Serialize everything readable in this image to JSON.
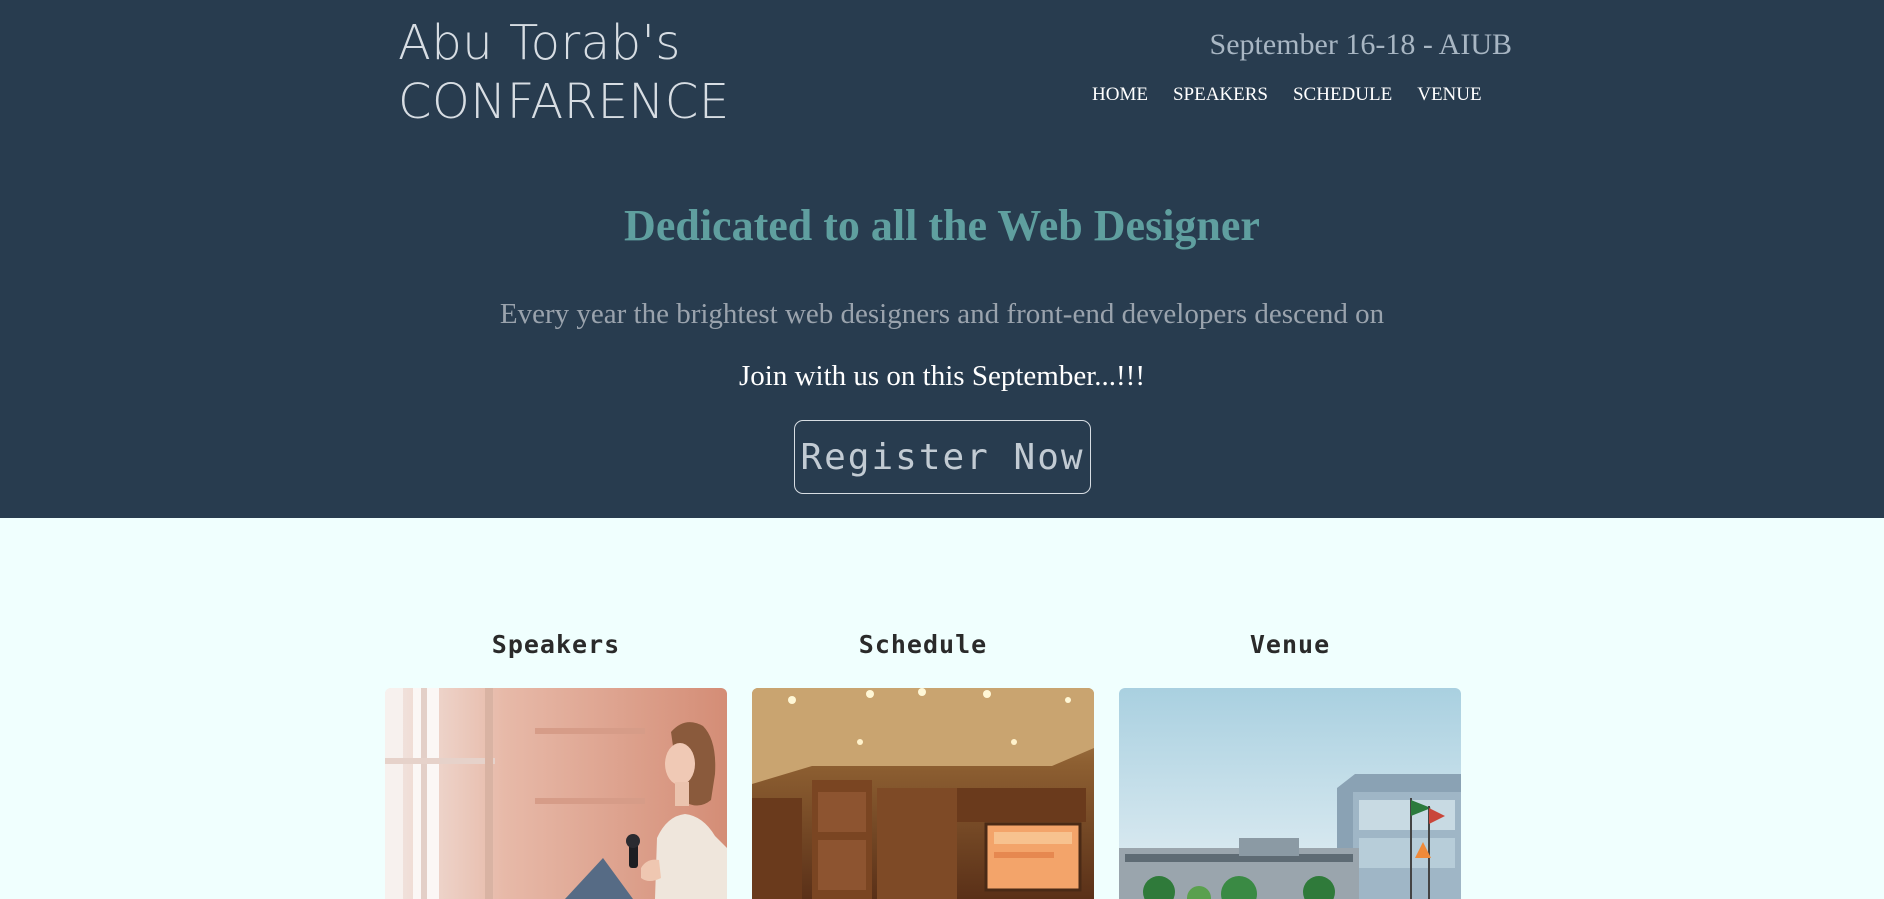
{
  "header": {
    "brand_line1": "Abu Torab's",
    "brand_line2": "CONFARENCE",
    "date": "September 16-18 - AIUB",
    "nav": [
      {
        "label": "HOME"
      },
      {
        "label": "SPEAKERS"
      },
      {
        "label": "SCHEDULE"
      },
      {
        "label": "VENUE"
      }
    ]
  },
  "hero": {
    "tagline": "Dedicated to all the Web Designer",
    "lead": "Every year the brightest web designers and front-end developers descend on",
    "invite": "Join with us on this September...!!!",
    "register_label": "Register Now"
  },
  "cards": [
    {
      "title": "Speakers",
      "image": "speaker-woman-with-microphone"
    },
    {
      "title": "Schedule",
      "image": "conference-hall-with-projector"
    },
    {
      "title": "Venue",
      "image": "university-building-with-flags"
    }
  ],
  "colors": {
    "hero_bg": "#283c4f",
    "page_bg": "#f0fffe",
    "tagline": "#5f9f9f",
    "lead": "#9aa3ad"
  }
}
